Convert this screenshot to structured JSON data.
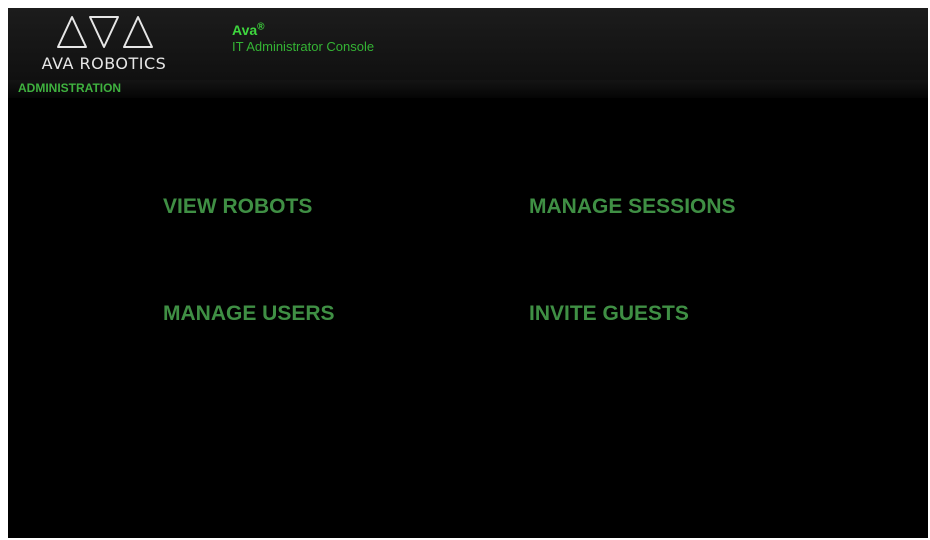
{
  "header": {
    "logo_text": "AVA ROBOTICS",
    "product_name": "Ava",
    "product_mark": "®",
    "product_subtitle": "IT Administrator Console"
  },
  "section": {
    "title": "ADMINISTRATION"
  },
  "menu": {
    "view_robots": "VIEW ROBOTS",
    "manage_sessions": "MANAGE SESSIONS",
    "manage_users": "MANAGE USERS",
    "invite_guests": "INVITE GUESTS"
  },
  "colors": {
    "background": "#000000",
    "header_bg": "#1a1a1a",
    "brand_green": "#3ed63e",
    "menu_green": "#3f8f44",
    "logo_text": "#e6e6e6"
  },
  "icons": {
    "logo": "ava-robotics-triangles-logo-icon"
  }
}
